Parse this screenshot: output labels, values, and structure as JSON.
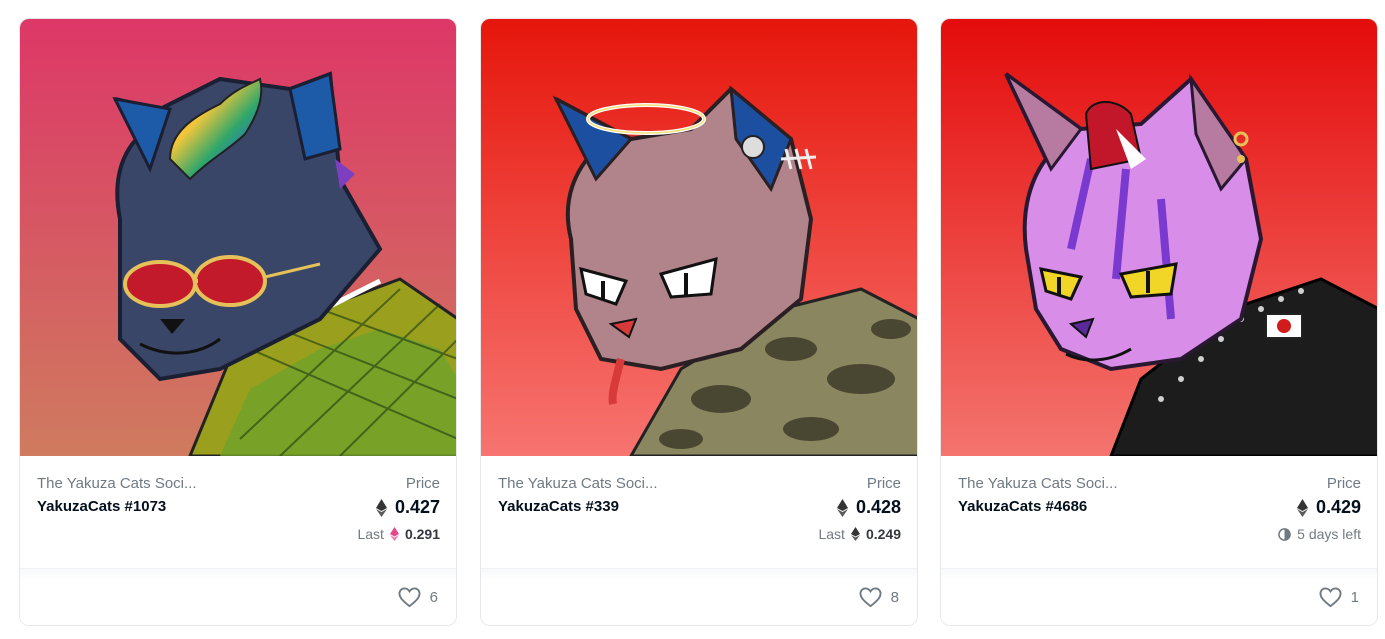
{
  "cards": [
    {
      "collection": "The Yakuza Cats Soci...",
      "name": "YakuzaCats #1073",
      "price_label": "Price",
      "price": "0.427",
      "sub_label": "Last",
      "sub_value": "0.291",
      "likes": "6"
    },
    {
      "collection": "The Yakuza Cats Soci...",
      "name": "YakuzaCats #339",
      "price_label": "Price",
      "price": "0.428",
      "sub_label": "Last",
      "sub_value": "0.249",
      "likes": "8"
    },
    {
      "collection": "The Yakuza Cats Soci...",
      "name": "YakuzaCats #4686",
      "price_label": "Price",
      "price": "0.429",
      "sub_label": "5 days left",
      "likes": "1"
    }
  ],
  "icons": {
    "currency": "ethereum-icon",
    "like": "heart-icon",
    "timer": "clock-icon"
  },
  "colors": {
    "eth_last_pink": "#e2468c",
    "text_muted": "#707a83",
    "text_dark": "#04111d"
  }
}
